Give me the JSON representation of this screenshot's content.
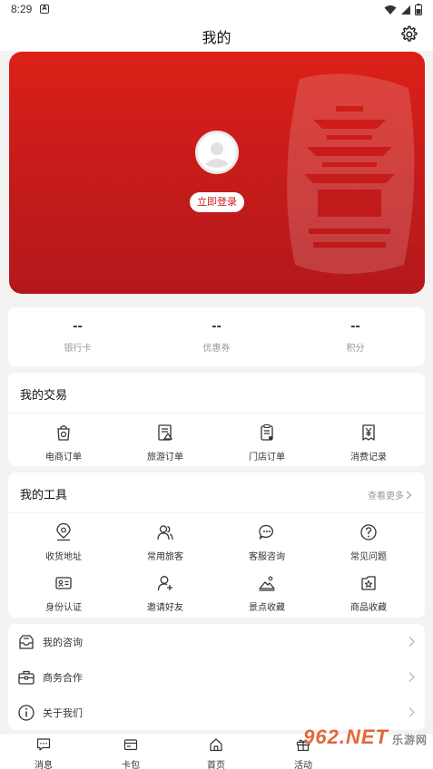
{
  "status_bar": {
    "time": "8:29",
    "app_icon": "A"
  },
  "header": {
    "title": "我的"
  },
  "profile": {
    "login_label": "立即登录"
  },
  "stats": [
    {
      "value": "--",
      "label": "银行卡"
    },
    {
      "value": "--",
      "label": "优惠券"
    },
    {
      "value": "--",
      "label": "积分"
    }
  ],
  "trade": {
    "title": "我的交易",
    "items": [
      {
        "label": "电商订单",
        "icon": "shopping-bag-icon"
      },
      {
        "label": "旅游订单",
        "icon": "travel-doc-icon"
      },
      {
        "label": "门店订单",
        "icon": "store-order-icon"
      },
      {
        "label": "消费记录",
        "icon": "yuan-receipt-icon"
      }
    ]
  },
  "tools": {
    "title": "我的工具",
    "more_label": "查看更多",
    "items": [
      {
        "label": "收货地址",
        "icon": "location-pin-icon"
      },
      {
        "label": "常用旅客",
        "icon": "users-icon"
      },
      {
        "label": "客服咨询",
        "icon": "chat-icon"
      },
      {
        "label": "常见问题",
        "icon": "question-icon"
      },
      {
        "label": "身份认证",
        "icon": "id-card-icon"
      },
      {
        "label": "邀请好友",
        "icon": "add-friend-icon"
      },
      {
        "label": "景点收藏",
        "icon": "landscape-icon"
      },
      {
        "label": "商品收藏",
        "icon": "star-box-icon"
      }
    ]
  },
  "menu": [
    {
      "label": "我的咨询",
      "icon": "inbox-icon"
    },
    {
      "label": "商务合作",
      "icon": "briefcase-icon"
    },
    {
      "label": "关于我们",
      "icon": "info-icon"
    }
  ],
  "tabbar": [
    {
      "label": "消息",
      "icon": "message-icon"
    },
    {
      "label": "卡包",
      "icon": "card-wallet-icon"
    },
    {
      "label": "首页",
      "icon": "home-icon"
    },
    {
      "label": "活动",
      "icon": "gift-icon"
    }
  ],
  "watermark": {
    "brand": "962.NET",
    "sub": "乐游网"
  },
  "colors": {
    "brand_red": "#c81c1a",
    "background": "#f3f3f3"
  }
}
